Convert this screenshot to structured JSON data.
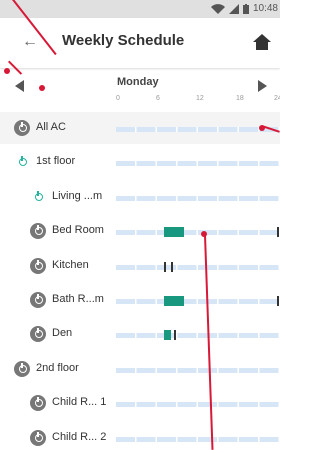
{
  "status": {
    "time": "10:48"
  },
  "appbar": {
    "title": "Weekly Schedule"
  },
  "dayrow": {
    "day": "Monday",
    "ticks": [
      "0",
      "6",
      "12",
      "18",
      "24"
    ]
  },
  "rows": [
    {
      "label": "All AC",
      "icon": "power-icon-gray",
      "segments": [],
      "dashes": []
    },
    {
      "label": "1st floor",
      "icon": "power-icon-teal",
      "segments": [],
      "dashes": []
    },
    {
      "label": "Living ...m",
      "icon": "power-icon-teal",
      "segments": [],
      "dashes": []
    },
    {
      "label": "Bed Room",
      "icon": "power-icon-gray",
      "segments": [
        {
          "from": "7:00",
          "to": "10:00"
        }
      ],
      "dashes": [
        "23:30"
      ]
    },
    {
      "label": "Kitchen",
      "icon": "power-icon-gray",
      "segments": [],
      "dashes": [
        "7:00",
        "8:00"
      ]
    },
    {
      "label": "Bath R...m",
      "icon": "power-icon-gray",
      "segments": [
        {
          "from": "7:00",
          "to": "10:00"
        }
      ],
      "dashes": [
        "23:30"
      ]
    },
    {
      "label": "Den",
      "icon": "power-icon-gray",
      "segments": [
        {
          "from": "7:00",
          "to": "8:00"
        }
      ],
      "dashes": [
        "8:30"
      ]
    },
    {
      "label": "2nd floor",
      "icon": "power-icon-gray",
      "segments": [],
      "dashes": []
    },
    {
      "label": "Child R... 1",
      "icon": "power-icon-gray",
      "segments": [],
      "dashes": []
    },
    {
      "label": "Child R... 2",
      "icon": "power-icon-gray",
      "segments": [],
      "dashes": []
    }
  ],
  "colors": {
    "accent": "#17987f",
    "track": "#d6e6f6",
    "annotation": "#d71937",
    "statusbar": "#e0e0e0"
  }
}
